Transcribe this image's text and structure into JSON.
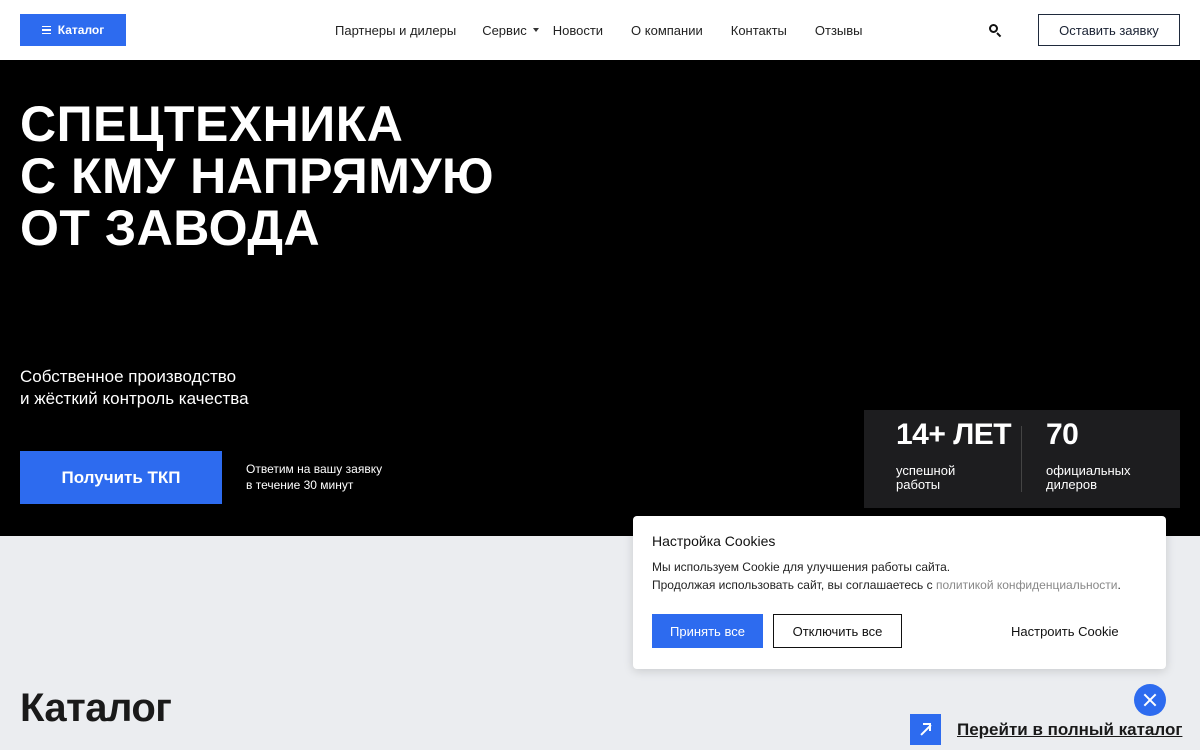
{
  "header": {
    "catalog_label": "Каталог",
    "nav": [
      {
        "label": "Партнеры и дилеры",
        "has_dropdown": false
      },
      {
        "label": "Сервис",
        "has_dropdown": true
      },
      {
        "label": "Новости",
        "has_dropdown": false
      },
      {
        "label": "О компании",
        "has_dropdown": false
      },
      {
        "label": "Контакты",
        "has_dropdown": false
      },
      {
        "label": "Отзывы",
        "has_dropdown": false
      }
    ],
    "search_icon": "search-icon",
    "leave_request_label": "Оставить заявку"
  },
  "hero": {
    "title_lines": [
      "СПЕЦТЕХНИКА",
      "С КМУ НАПРЯМУЮ",
      "ОТ ЗАВОДА"
    ],
    "subtitle_lines": [
      "Собственное производство",
      "и жёсткий контроль качества"
    ],
    "cta_label": "Получить ТКП",
    "reply_note_lines": [
      "Ответим на вашу заявку",
      "в течение 30 минут"
    ],
    "stats": [
      {
        "value": "14+ ЛЕТ",
        "label_lines": [
          "успешной",
          "работы"
        ]
      },
      {
        "value": "70",
        "label_lines": [
          "официальных",
          "дилеров"
        ]
      }
    ]
  },
  "catalog": {
    "title": "Каталог",
    "full_catalog_label": "Перейти в полный каталог"
  },
  "cookie": {
    "title": "Настройка Cookies",
    "line1": "Мы используем Cookie для улучшения работы сайта.",
    "line2_prefix": "Продолжая использовать сайт, вы соглашаетесь с ",
    "line2_link": "политикой конфиденциальности",
    "line2_suffix": ".",
    "accept_label": "Принять все",
    "decline_label": "Отключить все",
    "configure_label": "Настроить Cookie"
  },
  "colors": {
    "accent": "#2d6bef",
    "hero_bg": "#000000",
    "page_bg": "#ebedf0",
    "stats_bg": "#1d1d1f"
  }
}
